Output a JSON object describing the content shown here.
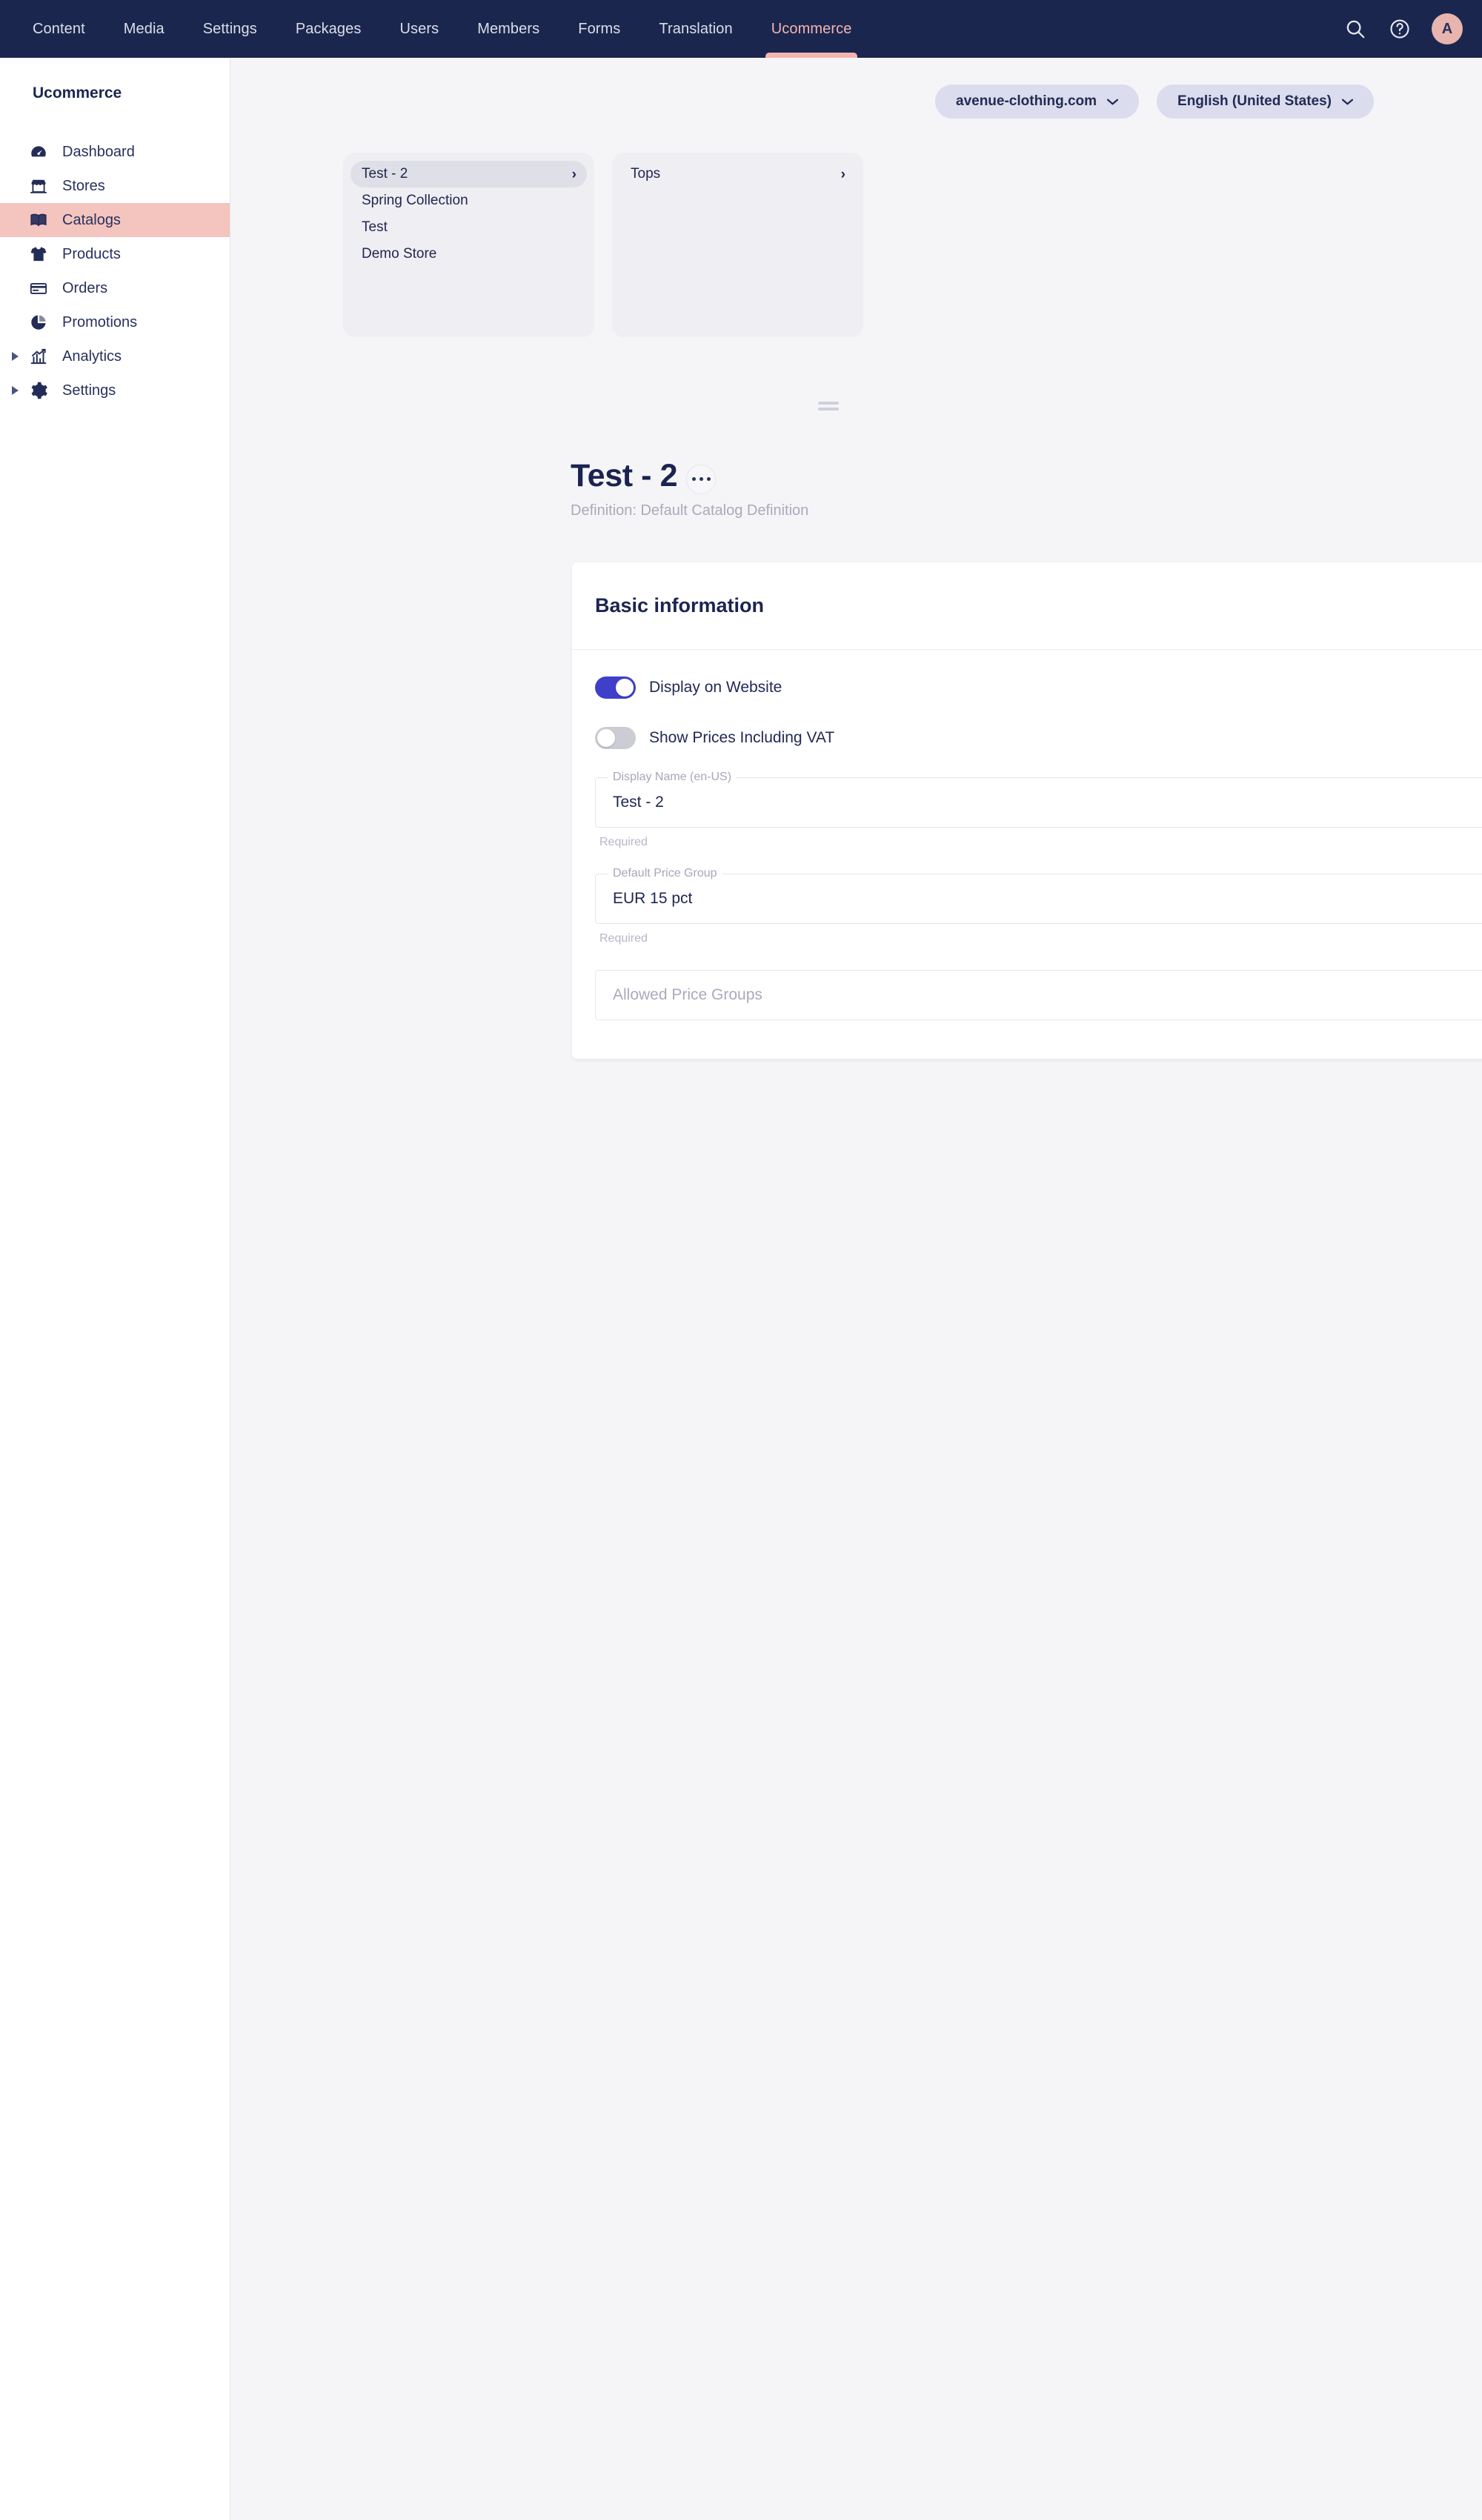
{
  "topnav": {
    "items": [
      {
        "label": "Content",
        "active": false
      },
      {
        "label": "Media",
        "active": false
      },
      {
        "label": "Settings",
        "active": false
      },
      {
        "label": "Packages",
        "active": false
      },
      {
        "label": "Users",
        "active": false
      },
      {
        "label": "Members",
        "active": false
      },
      {
        "label": "Forms",
        "active": false
      },
      {
        "label": "Translation",
        "active": false
      },
      {
        "label": "Ucommerce",
        "active": true
      }
    ],
    "search_icon": "search-icon",
    "help_icon": "help-icon",
    "avatar_initial": "A",
    "background_color": "#1b264f",
    "active_color": "#f2b6ae"
  },
  "sidebar": {
    "title": "Ucommerce",
    "items": [
      {
        "label": "Dashboard",
        "icon": "dashboard-icon",
        "active": false,
        "expandable": false
      },
      {
        "label": "Stores",
        "icon": "store-icon",
        "active": false,
        "expandable": false
      },
      {
        "label": "Catalogs",
        "icon": "book-icon",
        "active": true,
        "expandable": false
      },
      {
        "label": "Products",
        "icon": "tshirt-icon",
        "active": false,
        "expandable": false
      },
      {
        "label": "Orders",
        "icon": "card-icon",
        "active": false,
        "expandable": false
      },
      {
        "label": "Promotions",
        "icon": "piechart-icon",
        "active": false,
        "expandable": false
      },
      {
        "label": "Analytics",
        "icon": "chart-up-icon",
        "active": false,
        "expandable": true
      },
      {
        "label": "Settings",
        "icon": "gear-icon",
        "active": false,
        "expandable": true
      }
    ],
    "active_highlight_color": "#f4c4bf"
  },
  "context_bar": {
    "store_selector": {
      "label": "avenue-clothing.com",
      "icon": "chevron-down-icon"
    },
    "language_selector": {
      "label": "English (United States)",
      "icon": "chevron-down-icon"
    }
  },
  "tree": {
    "columns": [
      {
        "nodes": [
          {
            "label": "Test - 2",
            "selected": true,
            "has_children": true
          },
          {
            "label": "Spring Collection",
            "selected": false,
            "has_children": false
          },
          {
            "label": "Test",
            "selected": false,
            "has_children": false
          },
          {
            "label": "Demo Store",
            "selected": false,
            "has_children": false
          }
        ]
      },
      {
        "nodes": [
          {
            "label": "Tops",
            "selected": false,
            "has_children": true
          }
        ]
      }
    ]
  },
  "page": {
    "title": "Test - 2",
    "more_icon": "ellipsis-icon",
    "subtitle": "Definition: Default Catalog Definition"
  },
  "card": {
    "heading": "Basic information",
    "switches": [
      {
        "label": "Display on Website",
        "on": true
      },
      {
        "label": "Show Prices Including VAT",
        "on": false
      }
    ],
    "fields": [
      {
        "kind": "text",
        "legend": "Display Name (en-US)",
        "value": "Test - 2",
        "help": "Required"
      },
      {
        "kind": "select",
        "legend": "Default Price Group",
        "value": "EUR 15 pct",
        "help": "Required",
        "icon": "chevron-down-icon"
      },
      {
        "kind": "select-empty",
        "legend": "",
        "value": "",
        "placeholder": "Allowed Price Groups",
        "help": "",
        "icon": "chevron-down-icon"
      }
    ]
  },
  "colors": {
    "nav_background": "#1b264f",
    "accent_pink": "#f3b5ad",
    "toggle_on": "#3f3fcc",
    "toggle_off": "#cccdd4",
    "page_background": "#f5f5f7",
    "text_primary": "#1e2651"
  }
}
